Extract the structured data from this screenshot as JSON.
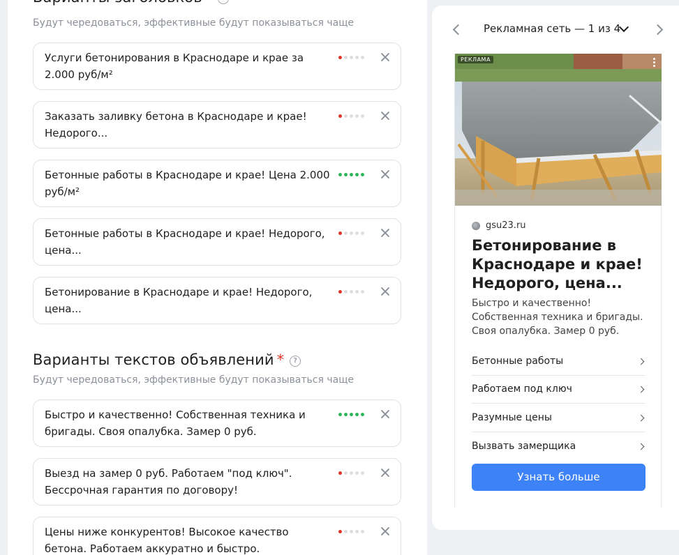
{
  "headlines_section": {
    "title": "Варианты заголовков",
    "required_mark": "*",
    "hint": "Будут чередоваться, эффективные будут показываться чаще",
    "items": [
      {
        "text": "Услуги бетонирования в Краснодаре и крае за 2.000 руб/м²",
        "quality": 1
      },
      {
        "text": "Заказать заливку бетона в Краснодаре и крае! Недорого...",
        "quality": 1
      },
      {
        "text": "Бетонные работы в Краснодаре и крае! Цена 2.000 руб/м²",
        "quality": 5
      },
      {
        "text": "Бетонные работы в Краснодаре и крае! Недорого, цена...",
        "quality": 1
      },
      {
        "text": "Бетонирование в Краснодаре и крае! Недорого, цена...",
        "quality": 1
      }
    ]
  },
  "texts_section": {
    "title": "Варианты текстов объявлений",
    "required_mark": "*",
    "hint": "Будут чередоваться, эффективные будут показываться чаще",
    "items": [
      {
        "text": "Быстро и качественно! Собственная техника и бригады. Своя опалубка. Замер 0 руб.",
        "quality": 5
      },
      {
        "text": "Выезд на замер 0 руб. Работаем \"под ключ\". Бессрочная гарантия по договору!",
        "quality": 1
      },
      {
        "text": "Цены ниже конкурентов! Высокое качество бетона. Работаем аккуратно и быстро.",
        "quality": 1
      }
    ]
  },
  "help_icon_glyph": "?",
  "preview": {
    "network_title": "Рекламная сеть — 1 из 4",
    "ad_badge": "РЕКЛАМА",
    "domain": "gsu23.ru",
    "ad_title": "Бетонирование в Краснодаре и крае! Недорого, цена...",
    "ad_text": "Быстро и качественно! Собственная техника и бригады. Своя опалубка. Замер 0 руб.",
    "sitelinks": [
      "Бетонные работы",
      "Работаем под ключ",
      "Разумные цены",
      "Вызвать замерщика"
    ],
    "cta_label": "Узнать больше"
  },
  "colors": {
    "accent": "#3e82f7",
    "required": "#e0352b",
    "quality_good": "#2eb55a",
    "quality_bad": "#e0352b"
  }
}
